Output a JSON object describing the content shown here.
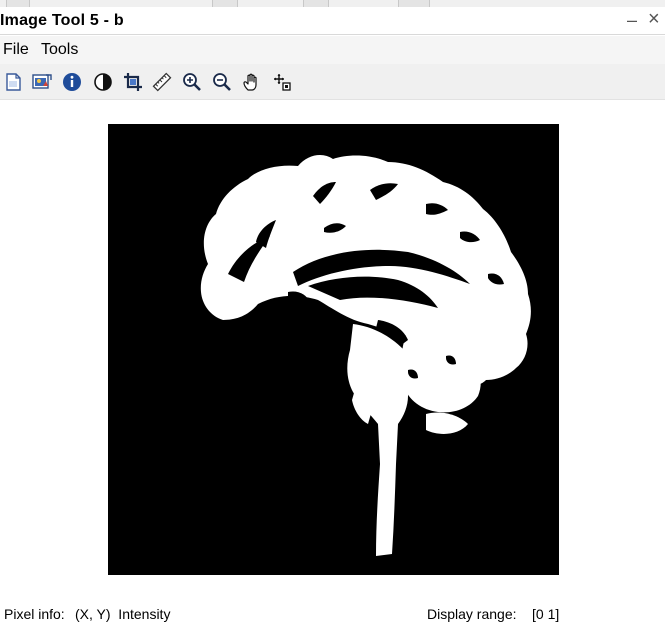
{
  "window": {
    "title": "Image Tool 5 - b",
    "minimize_glyph": "–",
    "close_glyph": "×"
  },
  "menu": {
    "items": [
      "File",
      "Tools"
    ]
  },
  "toolbar": {
    "tools": [
      "new-figure-icon",
      "export-image-icon",
      "image-info-icon",
      "contrast-icon",
      "crop-icon",
      "measure-distance-icon",
      "zoom-in-icon",
      "zoom-out-icon",
      "pan-hand-icon",
      "pixel-region-icon"
    ]
  },
  "image": {
    "name": "b",
    "colors": {
      "background": "#000000",
      "foreground": "#ffffff"
    }
  },
  "status": {
    "pixel_info_label": "Pixel info:",
    "pixel_info_value": "(X, Y)  Intensity",
    "display_range_label": "Display range:",
    "display_range_value": "[0 1]"
  }
}
